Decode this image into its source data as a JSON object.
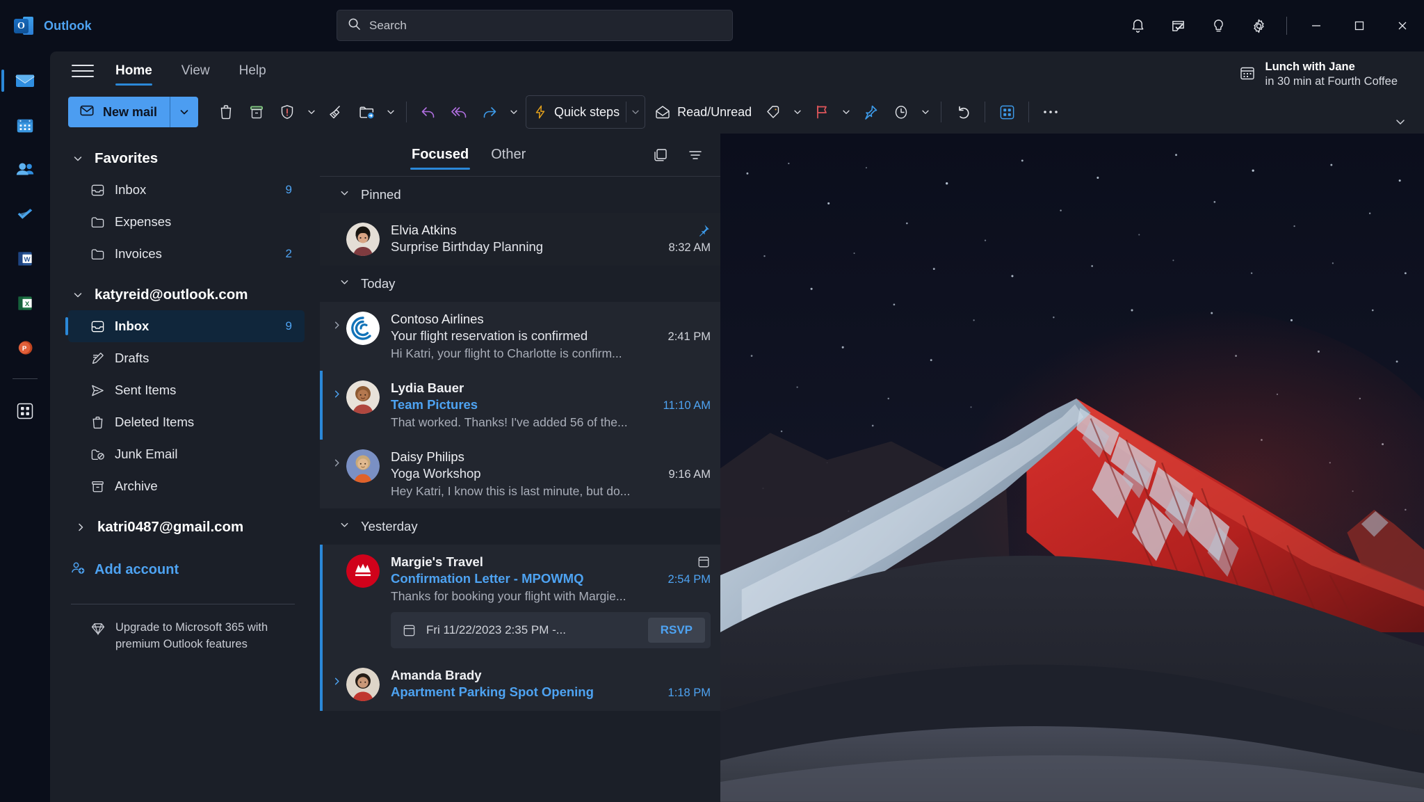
{
  "titlebar": {
    "app_name": "Outlook",
    "logo_letter": "O",
    "search_placeholder": "Search",
    "search_value": "",
    "icons": [
      {
        "name": "notifications-icon",
        "label": "Notifications"
      },
      {
        "name": "todo-icon",
        "label": "My Day"
      },
      {
        "name": "tips-icon",
        "label": "Tips"
      },
      {
        "name": "settings-icon",
        "label": "Settings"
      }
    ],
    "window_controls": [
      {
        "name": "minimize-button",
        "label": "Minimize"
      },
      {
        "name": "maximize-button",
        "label": "Maximize"
      },
      {
        "name": "close-button",
        "label": "Close"
      }
    ]
  },
  "rail": {
    "items": [
      {
        "name": "rail-mail",
        "label": "Mail",
        "active": true
      },
      {
        "name": "rail-calendar",
        "label": "Calendar",
        "active": false
      },
      {
        "name": "rail-people",
        "label": "People",
        "active": false
      },
      {
        "name": "rail-todo",
        "label": "To Do",
        "active": false
      },
      {
        "name": "rail-word",
        "label": "Word",
        "active": false
      },
      {
        "name": "rail-excel",
        "label": "Excel",
        "active": false
      },
      {
        "name": "rail-powerpoint",
        "label": "PowerPoint",
        "active": false
      },
      {
        "name": "rail-apps",
        "label": "More apps",
        "active": false
      }
    ]
  },
  "ribbon": {
    "tabs": [
      {
        "label": "Home",
        "active": true
      },
      {
        "label": "View",
        "active": false
      },
      {
        "label": "Help",
        "active": false
      }
    ],
    "meeting": {
      "title": "Lunch with Jane",
      "subtitle": "in 30 min at Fourth Coffee"
    }
  },
  "toolbar": {
    "new_mail_label": "New mail",
    "quick_steps_label": "Quick steps",
    "read_unread_label": "Read/Unread",
    "buttons": [
      {
        "name": "delete-button",
        "label": "Delete"
      },
      {
        "name": "archive-button",
        "label": "Archive"
      },
      {
        "name": "report-button",
        "label": "Report"
      },
      {
        "name": "sweep-button",
        "label": "Sweep"
      },
      {
        "name": "move-to-button",
        "label": "Move to"
      },
      {
        "name": "reply-button",
        "label": "Reply"
      },
      {
        "name": "reply-all-button",
        "label": "Reply all"
      },
      {
        "name": "forward-button",
        "label": "Forward"
      },
      {
        "name": "tag-button",
        "label": "Tag"
      },
      {
        "name": "flag-button",
        "label": "Flag"
      },
      {
        "name": "pin-button",
        "label": "Pin"
      },
      {
        "name": "snooze-button",
        "label": "Snooze"
      },
      {
        "name": "undo-button",
        "label": "Undo"
      },
      {
        "name": "apps-button",
        "label": "Apps"
      },
      {
        "name": "more-options-button",
        "label": "More options"
      }
    ]
  },
  "folders": {
    "favorites": {
      "label": "Favorites",
      "items": [
        {
          "name": "Inbox",
          "count": "9",
          "icon": "inbox-icon"
        },
        {
          "name": "Expenses",
          "count": "",
          "icon": "folder-icon"
        },
        {
          "name": "Invoices",
          "count": "2",
          "icon": "folder-icon"
        }
      ]
    },
    "account_primary": {
      "label": "katyreid@outlook.com",
      "items": [
        {
          "name": "Inbox",
          "count": "9",
          "icon": "inbox-icon",
          "active": true
        },
        {
          "name": "Drafts",
          "count": "",
          "icon": "drafts-icon",
          "active": false
        },
        {
          "name": "Sent Items",
          "count": "",
          "icon": "sent-icon",
          "active": false
        },
        {
          "name": "Deleted Items",
          "count": "",
          "icon": "trash-icon",
          "active": false
        },
        {
          "name": "Junk Email",
          "count": "",
          "icon": "junk-icon",
          "active": false
        },
        {
          "name": "Archive",
          "count": "",
          "icon": "archive-icon",
          "active": false
        }
      ]
    },
    "account_secondary": {
      "label": "katri0487@gmail.com"
    },
    "add_account_label": "Add account",
    "upgrade_text": "Upgrade to Microsoft 365 with premium Outlook features"
  },
  "message_list": {
    "pivots": [
      {
        "label": "Focused",
        "active": true
      },
      {
        "label": "Other",
        "active": false
      }
    ],
    "actions": [
      {
        "name": "conversation-view-icon",
        "label": "Conversation view"
      },
      {
        "name": "filter-icon",
        "label": "Filter"
      }
    ],
    "groups": [
      {
        "header": "Pinned",
        "messages": [
          {
            "sender": "Elvia Atkins",
            "subject": "Surprise Birthday Planning",
            "preview": "",
            "time": "8:32 AM",
            "unread": false,
            "pinned": true,
            "badge": "pin-icon",
            "avatar_color": "#d9c6b8",
            "has_expander": false
          }
        ]
      },
      {
        "header": "Today",
        "messages": [
          {
            "sender": "Contoso Airlines",
            "subject": "Your flight reservation is confirmed",
            "preview": "Hi Katri, your flight to Charlotte is confirm...",
            "time": "2:41 PM",
            "unread": false,
            "pinned": false,
            "badge": "",
            "avatar_color": "#ffffff",
            "avatar_letter": "C",
            "has_expander": true
          },
          {
            "sender": "Lydia Bauer",
            "subject": "Team Pictures",
            "preview": "That worked. Thanks! I've added 56 of the...",
            "time": "11:10 AM",
            "unread": true,
            "pinned": false,
            "badge": "",
            "avatar_color": "#c9a88a",
            "has_expander": true
          },
          {
            "sender": "Daisy Philips",
            "subject": "Yoga Workshop",
            "preview": "Hey Katri, I know this is last minute, but do...",
            "time": "9:16 AM",
            "unread": false,
            "pinned": false,
            "badge": "",
            "avatar_color": "#7a90c4",
            "has_expander": true
          }
        ]
      },
      {
        "header": "Yesterday",
        "messages": [
          {
            "sender": "Margie's Travel",
            "subject": "Confirmation Letter - MPOWMQ",
            "preview": "Thanks for booking your flight with Margie...",
            "time": "2:54 PM",
            "unread": true,
            "pinned": false,
            "badge": "calendar-icon",
            "avatar_color": "#d0021b",
            "has_expander": false,
            "rsvp": {
              "when": "Fri 11/22/2023 2:35 PM -...",
              "button_label": "RSVP"
            }
          },
          {
            "sender": "Amanda Brady",
            "subject": "Apartment Parking Spot Opening",
            "preview": "",
            "time": "1:18 PM",
            "unread": true,
            "pinned": false,
            "badge": "",
            "avatar_color": "#c7b299",
            "has_expander": true
          }
        ]
      }
    ]
  },
  "colors": {
    "accent": "#2b88d8",
    "accent_light": "#4ea3f2",
    "new_mail": "#4c9df1",
    "unread": "#4ea3f2"
  }
}
